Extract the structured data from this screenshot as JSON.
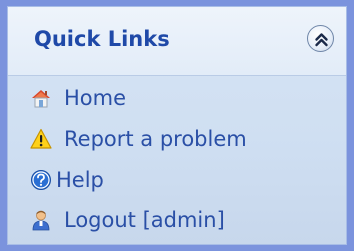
{
  "panel": {
    "title": "Quick Links",
    "collapse_icon": "double-chevron-up-icon"
  },
  "links": [
    {
      "label": "Home",
      "icon": "home-icon"
    },
    {
      "label": "Report a problem",
      "icon": "warning-icon"
    },
    {
      "label": "Help",
      "icon": "help-icon"
    },
    {
      "label": "Logout [admin]",
      "icon": "user-icon"
    }
  ],
  "colors": {
    "frame_border": "#7b93dd",
    "panel_background": "#cfdff2",
    "title_text": "#1f49a8",
    "link_text": "#2a4fa6"
  }
}
